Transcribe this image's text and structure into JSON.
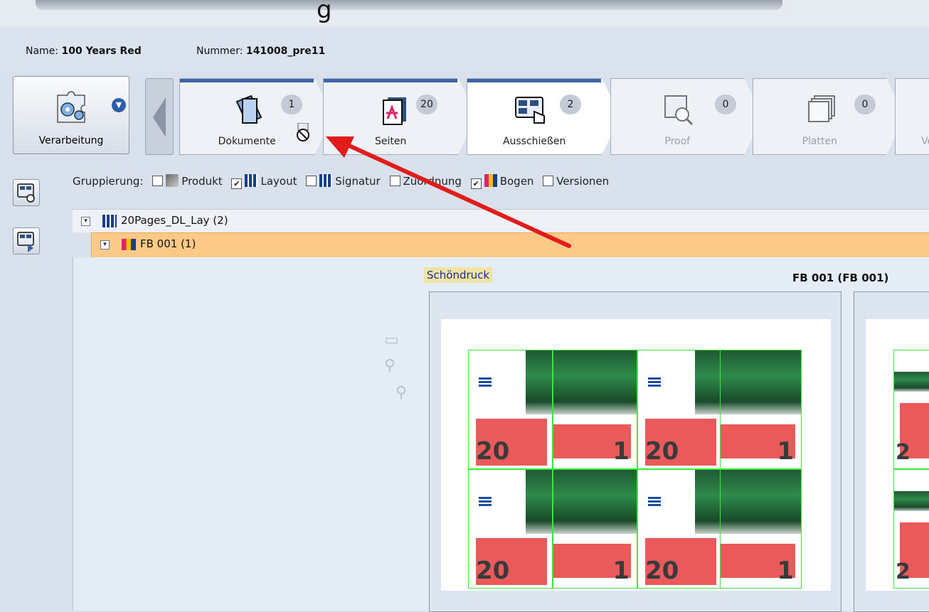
{
  "header": {
    "name_label": "Name:",
    "name_value": "100 Years Red",
    "number_label": "Nummer:",
    "number_value": "141008_pre11",
    "title_fragment": "g"
  },
  "toolbar": {
    "processing_label": "Verarbeitung",
    "tabs": [
      {
        "label": "Dokumente",
        "count": "1",
        "state": "normal"
      },
      {
        "label": "Seiten",
        "count": "20",
        "state": "normal"
      },
      {
        "label": "Ausschießen",
        "count": "2",
        "state": "active"
      },
      {
        "label": "Proof",
        "count": "0",
        "state": "inactive"
      },
      {
        "label": "Platten",
        "count": "0",
        "state": "inactive"
      },
      {
        "label": "Ve",
        "count": "",
        "state": "inactive"
      }
    ]
  },
  "grouping": {
    "label": "Gruppierung:",
    "options": [
      {
        "label": "Produkt",
        "checked": false
      },
      {
        "label": "Layout",
        "checked": true
      },
      {
        "label": "Signatur",
        "checked": false
      },
      {
        "label": "Zuordnung",
        "checked": false
      },
      {
        "label": "Bogen",
        "checked": true
      },
      {
        "label": "Versionen",
        "checked": false
      }
    ]
  },
  "tree": {
    "layout_node": "20Pages_DL_Lay (2)",
    "sheet_node": "FB 001 (1)"
  },
  "preview": {
    "side_label": "Schöndruck",
    "sheet_title": "FB 001 (FB 001)",
    "page_numbers": [
      "20",
      "1",
      "20",
      "1",
      "20",
      "1",
      "20",
      "1"
    ],
    "partial_page_numbers": [
      "2",
      "2"
    ]
  },
  "colors": {
    "accent_blue": "#3e63a8",
    "selection_orange": "#fdc987",
    "arrow_red": "#e21b1b",
    "trim_green": "#3ce63c",
    "page_red": "#ea5a5a"
  }
}
